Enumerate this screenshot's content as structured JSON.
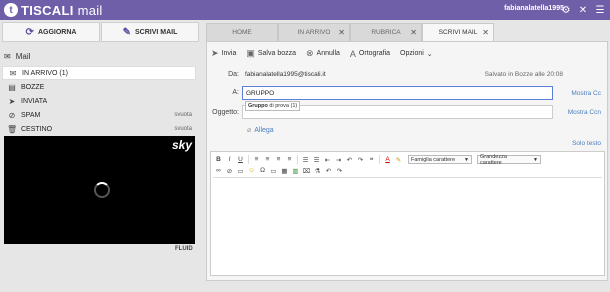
{
  "topbar": {
    "logo_mark": "t",
    "brand_bold": "TISCALI",
    "brand_light": "mail",
    "user": "fabianalatella1995",
    "icons": [
      "gear-icon",
      "close-icon",
      "menu-icon"
    ]
  },
  "sidebar": {
    "refresh_label": "AGGIORNA",
    "compose_label": "SCRIVI MAIL",
    "mail_header": "Mail",
    "folders": [
      {
        "label": "IN ARRIVO",
        "count": "(1)",
        "icon": "inbox-icon",
        "action": ""
      },
      {
        "label": "BOZZE",
        "count": "",
        "icon": "drafts-icon",
        "action": ""
      },
      {
        "label": "INVIATA",
        "count": "",
        "icon": "sent-icon",
        "action": ""
      },
      {
        "label": "SPAM",
        "count": "",
        "icon": "spam-icon",
        "action": "svuota"
      },
      {
        "label": "CESTINO",
        "count": "",
        "icon": "trash-icon",
        "action": "svuota"
      }
    ],
    "ad_brand": "sky",
    "ad_footer": "FLUID"
  },
  "tabs": [
    {
      "label": "HOME",
      "closable": false,
      "active": false
    },
    {
      "label": "IN ARRIVO",
      "closable": true,
      "active": false
    },
    {
      "label": "RUBRICA",
      "closable": true,
      "active": false
    },
    {
      "label": "SCRIVI MAIL",
      "closable": true,
      "active": true
    }
  ],
  "compose": {
    "toolbar": {
      "send": "Invia",
      "save_draft": "Salva bozza",
      "cancel": "Annulla",
      "spelling": "Ortografia",
      "options": "Opzioni"
    },
    "from_label": "Da:",
    "from_value": "fabianalatella1995@tiscali.it",
    "saved_status": "Salvato in Bozze alle 20:08",
    "to_label": "A:",
    "to_value": "GRUPPO",
    "suggestion_bold": "Gruppo",
    "suggestion_rest": " di prova (1)",
    "cc_link": "Mostra Cc",
    "subject_label": "Oggetto:",
    "subject_value": "",
    "ccn_link": "Mostra Ccn",
    "attach_label": "Allega",
    "plain_text_link": "Solo testo",
    "font_family_select": "Famiglia carattere",
    "font_size_select": "Grandezza carattere"
  },
  "colors": {
    "brand": "#6f5fa8",
    "link": "#4a7fc1",
    "focus": "#5b7fd6"
  }
}
